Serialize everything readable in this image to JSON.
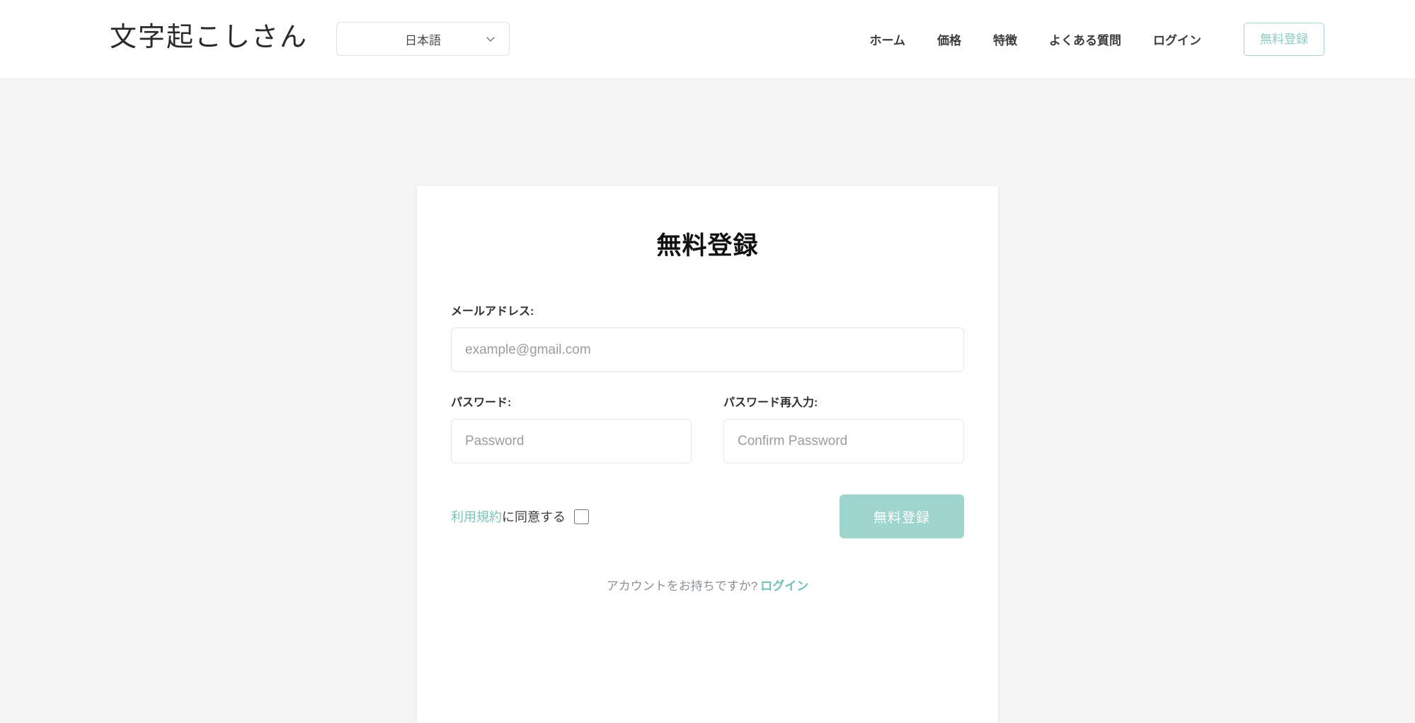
{
  "header": {
    "brand": "文字起こしさん",
    "language_select": {
      "value": "日本語",
      "icon": "chevron-down-icon"
    },
    "nav": [
      {
        "label": "ホーム",
        "name": "home"
      },
      {
        "label": "価格",
        "name": "pricing"
      },
      {
        "label": "特徴",
        "name": "features"
      },
      {
        "label": "よくある質問",
        "name": "faq"
      },
      {
        "label": "ログイン",
        "name": "login"
      }
    ],
    "cta_label": "無料登録"
  },
  "signup_card": {
    "title": "無料登録",
    "email": {
      "label": "メールアドレス:",
      "placeholder": "example@gmail.com",
      "value": ""
    },
    "password": {
      "label": "パスワード:",
      "placeholder": "Password",
      "value": ""
    },
    "confirm_password": {
      "label": "パスワード再入力:",
      "placeholder": "Confirm Password",
      "value": ""
    },
    "agreement": {
      "link_text": "利用規約",
      "rest_text": "に同意する",
      "checked": false
    },
    "submit_label": "無料登録",
    "footer": {
      "text": "アカウントをお持ちですか?",
      "link_text": "ログイン"
    }
  },
  "colors": {
    "accent_teal": "#9ed5cd",
    "link_teal": "#6fc0b6",
    "page_bg": "#f5f5f6",
    "card_bg": "#ffffff"
  }
}
